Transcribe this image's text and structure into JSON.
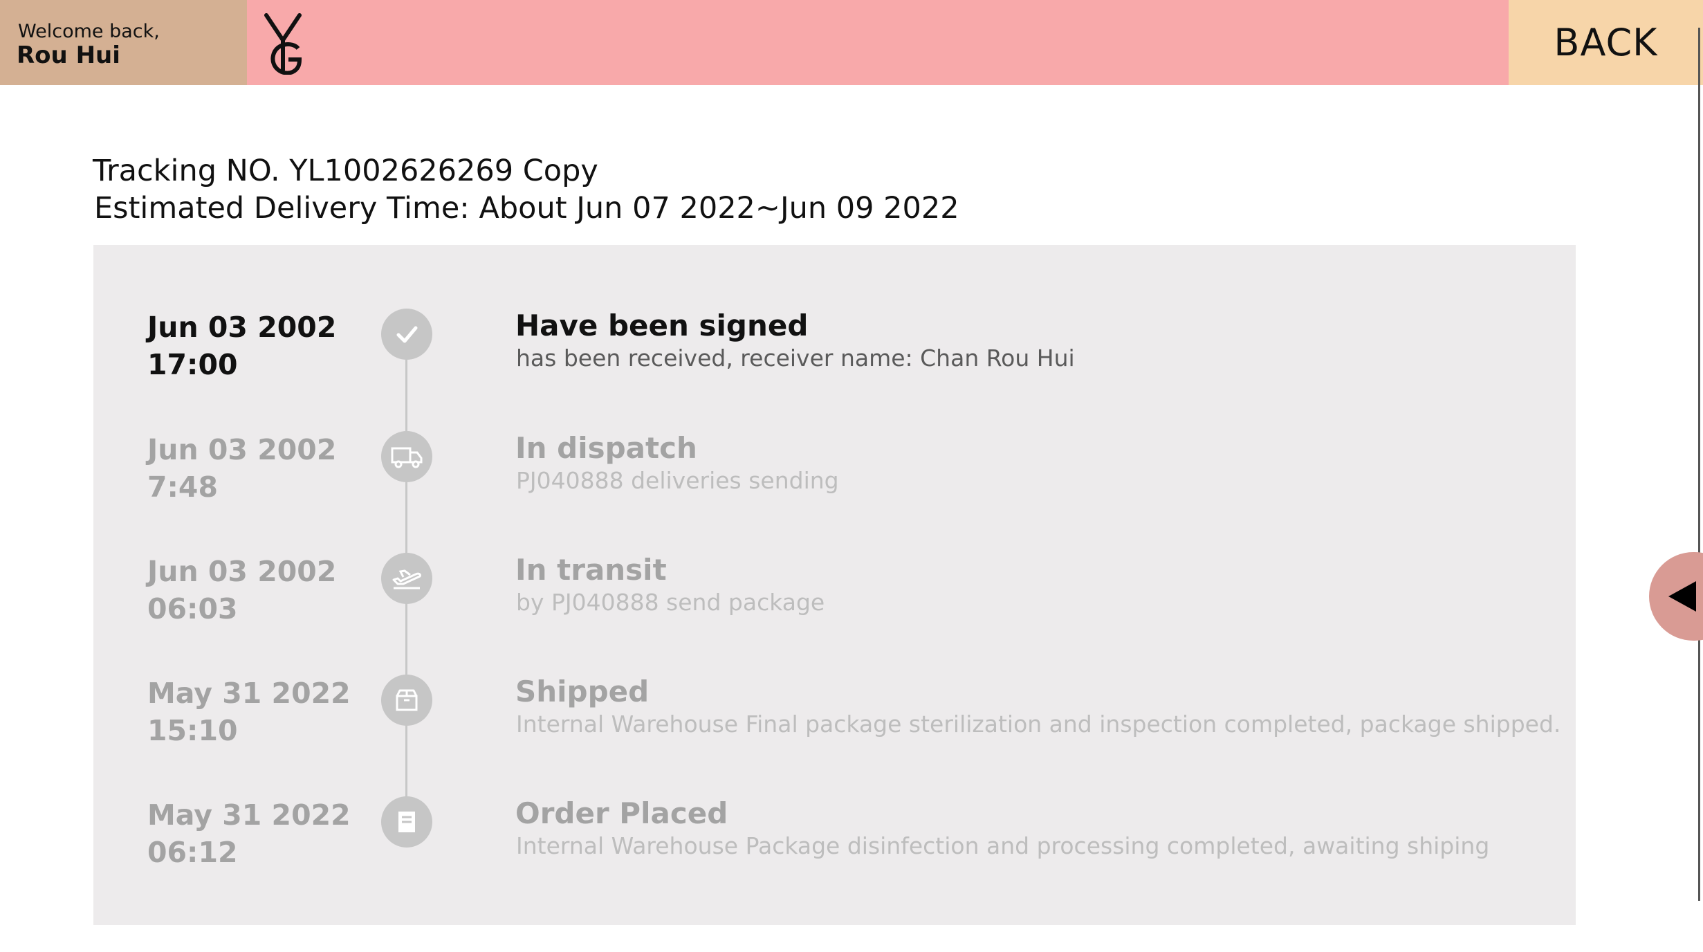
{
  "header": {
    "welcome_line": "Welcome back,",
    "user_name": "Rou Hui",
    "back_label": "BACK",
    "colors": {
      "welcome_bg": "#d4b093",
      "logo_bar_bg": "#f8a9aa",
      "back_bg": "#f7d5a9"
    }
  },
  "tracking": {
    "label": "Tracking NO. YL1002626269",
    "copy_label": "Copy",
    "eta_label": "Estimated Delivery Time: About Jun 07 2022~Jun 09 2022"
  },
  "timeline": [
    {
      "date": "Jun 03 2002",
      "time": "17:00",
      "title": "Have been signed",
      "desc": "has been received, receiver name: Chan Rou Hui",
      "icon": "check-icon",
      "active": true
    },
    {
      "date": "Jun 03 2002",
      "time": "7:48",
      "title": "In dispatch",
      "desc": "PJ040888 deliveries sending",
      "icon": "truck-icon",
      "active": false
    },
    {
      "date": "Jun 03 2002",
      "time": "06:03",
      "title": "In transit",
      "desc": "by PJ040888 send package",
      "icon": "plane-icon",
      "active": false
    },
    {
      "date": "May 31 2022",
      "time": "15:10",
      "title": "Shipped",
      "desc": "Internal Warehouse Final package sterilization and inspection completed, package shipped.",
      "icon": "box-icon",
      "active": false
    },
    {
      "date": "May 31 2022",
      "time": "06:12",
      "title": "Order Placed",
      "desc": "Internal Warehouse Package disinfection and processing completed, awaiting shiping",
      "icon": "receipt-icon",
      "active": false
    }
  ]
}
